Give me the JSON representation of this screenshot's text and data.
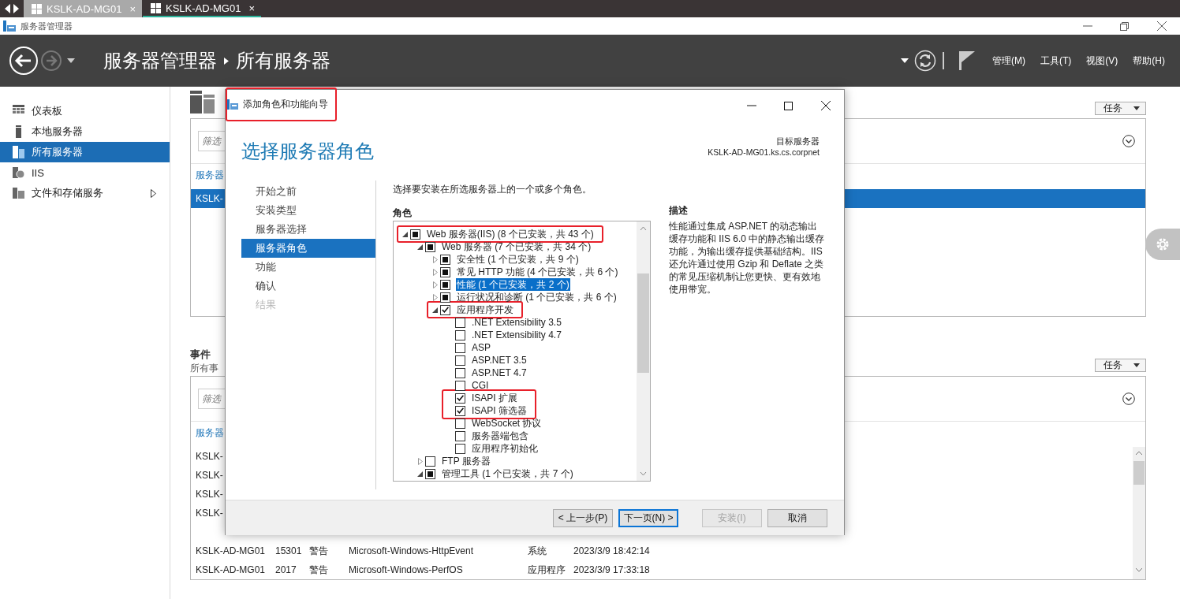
{
  "browser_tabs": [
    {
      "label": "KSLK-AD-MG01",
      "close": "×",
      "selected": false
    },
    {
      "label": "KSLK-AD-MG01",
      "close": "×",
      "selected": true
    }
  ],
  "window": {
    "title": "服务器管理器"
  },
  "header": {
    "breadcrumb": [
      "服务器管理器",
      "所有服务器"
    ],
    "menus": [
      "管理(M)",
      "工具(T)",
      "视图(V)",
      "帮助(H)"
    ]
  },
  "sidebar": {
    "items": [
      {
        "label": "仪表板",
        "selected": false,
        "has_submenu": false
      },
      {
        "label": "本地服务器",
        "selected": false,
        "has_submenu": false
      },
      {
        "label": "所有服务器",
        "selected": true,
        "has_submenu": false
      },
      {
        "label": "IIS",
        "selected": false,
        "has_submenu": false
      },
      {
        "label": "文件和存储服务",
        "selected": false,
        "has_submenu": true
      }
    ]
  },
  "servers_panel": {
    "tasks_button": "任务",
    "filter_placeholder": "筛选",
    "column_1": "服务器",
    "rows": [
      {
        "column_1": "KSLK-",
        "selected": true
      }
    ]
  },
  "events_panel": {
    "title": "事件",
    "subtitle": "所有事",
    "tasks_button": "任务",
    "filter_placeholder": "筛选",
    "column_1": "服务器",
    "partial_rows": [
      {
        "column_1": "KSLK-"
      },
      {
        "column_1": "KSLK-"
      },
      {
        "column_1": "KSLK-"
      },
      {
        "column_1": "KSLK-"
      }
    ],
    "rows": [
      {
        "cells": [
          "KSLK-AD-MG01",
          "15301",
          "警告",
          "Microsoft-Windows-HttpEvent",
          "系统",
          "2023/3/9 18:42:14"
        ]
      },
      {
        "cells": [
          "KSLK-AD-MG01",
          "2017",
          "警告",
          "Microsoft-Windows-PerfOS",
          "应用程序",
          "2023/3/9 17:33:18"
        ]
      }
    ]
  },
  "wizard": {
    "title": "添加角色和功能向导",
    "title_annotated": true,
    "heading": "选择服务器角色",
    "target_label": "目标服务器",
    "target_server": "KSLK-AD-MG01.ks.cs.corpnet",
    "steps": [
      {
        "label": "开始之前",
        "selected": false,
        "disabled": false
      },
      {
        "label": "安装类型",
        "selected": false,
        "disabled": false
      },
      {
        "label": "服务器选择",
        "selected": false,
        "disabled": false
      },
      {
        "label": "服务器角色",
        "selected": true,
        "disabled": false
      },
      {
        "label": "功能",
        "selected": false,
        "disabled": false
      },
      {
        "label": "确认",
        "selected": false,
        "disabled": false
      },
      {
        "label": "结果",
        "selected": false,
        "disabled": true
      }
    ],
    "instruction": "选择要安装在所选服务器上的一个或多个角色。",
    "roles_label": "角色",
    "roles": [
      {
        "label": "Web 服务器(IIS) (8 个已安装，共 43 个)",
        "checked": false,
        "indeterminate": true,
        "expanded": true,
        "selected": false,
        "annotated": true,
        "children": [
          {
            "label": "Web 服务器 (7 个已安装，共 34 个)",
            "checked": false,
            "indeterminate": true,
            "expanded": true,
            "selected": false,
            "annotated": false,
            "children": [
              {
                "label": "安全性 (1 个已安装，共 9 个)",
                "checked": false,
                "indeterminate": true,
                "expanded": false,
                "selected": false,
                "annotated": false
              },
              {
                "label": "常见 HTTP 功能 (4 个已安装，共 6 个)",
                "checked": false,
                "indeterminate": true,
                "expanded": false,
                "selected": false,
                "annotated": false
              },
              {
                "label": "性能 (1 个已安装，共 2 个)",
                "checked": false,
                "indeterminate": true,
                "expanded": false,
                "selected": true,
                "annotated": false
              },
              {
                "label": "运行状况和诊断 (1 个已安装，共 6 个)",
                "checked": false,
                "indeterminate": true,
                "expanded": false,
                "selected": false,
                "annotated": false
              },
              {
                "label": "应用程序开发",
                "checked": true,
                "indeterminate": false,
                "expanded": true,
                "selected": false,
                "annotated": true,
                "children": [
                  {
                    "label": ".NET Extensibility 3.5",
                    "checked": false,
                    "indeterminate": false,
                    "selected": false,
                    "annotated": false
                  },
                  {
                    "label": ".NET Extensibility 4.7",
                    "checked": false,
                    "indeterminate": false,
                    "selected": false,
                    "annotated": false
                  },
                  {
                    "label": "ASP",
                    "checked": false,
                    "indeterminate": false,
                    "selected": false,
                    "annotated": false
                  },
                  {
                    "label": "ASP.NET 3.5",
                    "checked": false,
                    "indeterminate": false,
                    "selected": false,
                    "annotated": false
                  },
                  {
                    "label": "ASP.NET 4.7",
                    "checked": false,
                    "indeterminate": false,
                    "selected": false,
                    "annotated": false
                  },
                  {
                    "label": "CGI",
                    "checked": false,
                    "indeterminate": false,
                    "selected": false,
                    "annotated": false
                  },
                  {
                    "label": "ISAPI 扩展",
                    "checked": true,
                    "indeterminate": false,
                    "selected": false,
                    "annotated": true
                  },
                  {
                    "label": "ISAPI 筛选器",
                    "checked": true,
                    "indeterminate": false,
                    "selected": false,
                    "annotated": true
                  },
                  {
                    "label": "WebSocket 协议",
                    "checked": false,
                    "indeterminate": false,
                    "selected": false,
                    "annotated": false
                  },
                  {
                    "label": "服务器端包含",
                    "checked": false,
                    "indeterminate": false,
                    "selected": false,
                    "annotated": false
                  },
                  {
                    "label": "应用程序初始化",
                    "checked": false,
                    "indeterminate": false,
                    "selected": false,
                    "annotated": false
                  }
                ]
              }
            ]
          },
          {
            "label": "FTP 服务器",
            "checked": false,
            "indeterminate": false,
            "expanded": false,
            "selected": false,
            "annotated": false
          },
          {
            "label": "管理工具 (1 个已安装，共 7 个)",
            "checked": false,
            "indeterminate": true,
            "expanded": true,
            "selected": false,
            "annotated": false
          }
        ]
      }
    ],
    "description_label": "描述",
    "description": "性能通过集成 ASP.NET 的动态输出缓存功能和 IIS 6.0 中的静态输出缓存功能，为输出缓存提供基础结构。IIS 还允许通过使用 Gzip 和 Deflate 之类的常见压缩机制让您更快、更有效地使用带宽。",
    "buttons": [
      {
        "label": "< 上一步(P)",
        "disabled": false,
        "default": false
      },
      {
        "label": "下一页(N) >",
        "disabled": false,
        "default": true
      },
      {
        "label": "安装(I)",
        "disabled": true,
        "default": false
      },
      {
        "label": "取消",
        "disabled": false,
        "default": false
      }
    ]
  }
}
